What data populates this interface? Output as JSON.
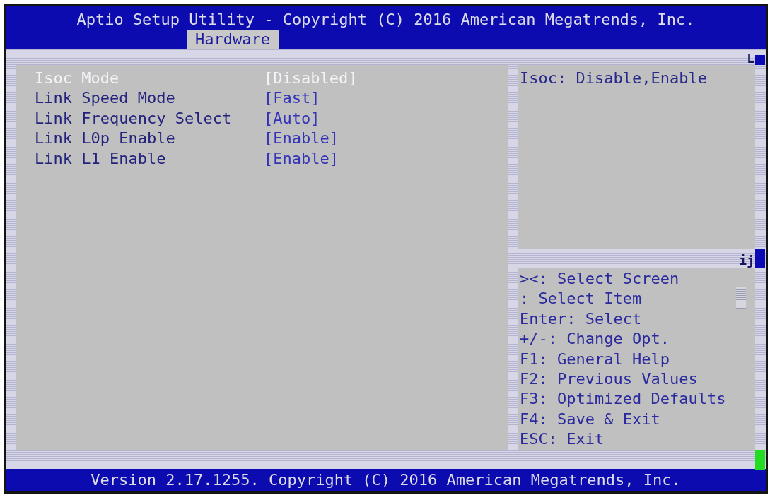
{
  "window": {
    "title": "Aptio Setup Utility - Copyright (C) 2016 American Megatrends, Inc."
  },
  "tabs": [
    {
      "label": "Hardware",
      "selected": true
    }
  ],
  "settings": [
    {
      "label": "Isoc Mode",
      "value": "[Disabled]",
      "selected": true
    },
    {
      "label": "Link Speed Mode",
      "value": "[Fast]",
      "selected": false
    },
    {
      "label": "Link Frequency Select",
      "value": "[Auto]",
      "selected": false
    },
    {
      "label": "Link L0p Enable",
      "value": "[Enable]",
      "selected": false
    },
    {
      "label": "Link L1 Enable",
      "value": "[Enable]",
      "selected": false
    }
  ],
  "help_text": "Isoc: Disable,Enable",
  "edge_glyphs": [
    "L",
    "ij"
  ],
  "key_hints": [
    "><: Select Screen",
    ": Select Item",
    "Enter: Select",
    "+/-: Change Opt.",
    "F1: General Help",
    "F2: Previous Values",
    "F3: Optimized Defaults",
    "F4: Save & Exit",
    "ESC: Exit"
  ],
  "status_bar": {
    "text": "Version 2.17.1255. Copyright (C) 2016 American Megatrends, Inc."
  }
}
